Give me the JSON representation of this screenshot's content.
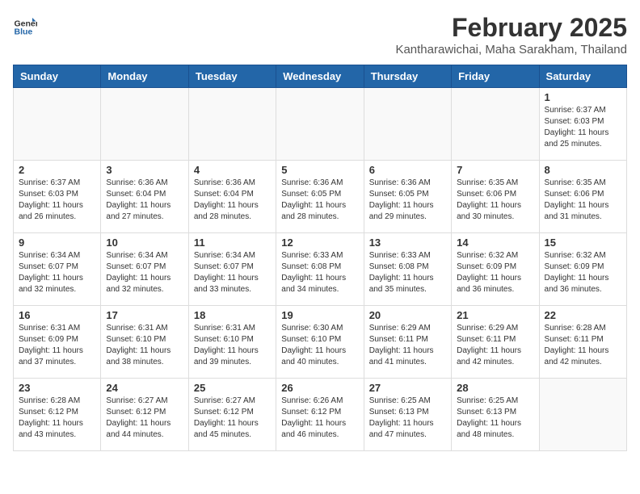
{
  "header": {
    "logo_general": "General",
    "logo_blue": "Blue",
    "month_year": "February 2025",
    "location": "Kantharawichai, Maha Sarakham, Thailand"
  },
  "days_of_week": [
    "Sunday",
    "Monday",
    "Tuesday",
    "Wednesday",
    "Thursday",
    "Friday",
    "Saturday"
  ],
  "weeks": [
    [
      {
        "day": "",
        "info": ""
      },
      {
        "day": "",
        "info": ""
      },
      {
        "day": "",
        "info": ""
      },
      {
        "day": "",
        "info": ""
      },
      {
        "day": "",
        "info": ""
      },
      {
        "day": "",
        "info": ""
      },
      {
        "day": "1",
        "info": "Sunrise: 6:37 AM\nSunset: 6:03 PM\nDaylight: 11 hours\nand 25 minutes."
      }
    ],
    [
      {
        "day": "2",
        "info": "Sunrise: 6:37 AM\nSunset: 6:03 PM\nDaylight: 11 hours\nand 26 minutes."
      },
      {
        "day": "3",
        "info": "Sunrise: 6:36 AM\nSunset: 6:04 PM\nDaylight: 11 hours\nand 27 minutes."
      },
      {
        "day": "4",
        "info": "Sunrise: 6:36 AM\nSunset: 6:04 PM\nDaylight: 11 hours\nand 28 minutes."
      },
      {
        "day": "5",
        "info": "Sunrise: 6:36 AM\nSunset: 6:05 PM\nDaylight: 11 hours\nand 28 minutes."
      },
      {
        "day": "6",
        "info": "Sunrise: 6:36 AM\nSunset: 6:05 PM\nDaylight: 11 hours\nand 29 minutes."
      },
      {
        "day": "7",
        "info": "Sunrise: 6:35 AM\nSunset: 6:06 PM\nDaylight: 11 hours\nand 30 minutes."
      },
      {
        "day": "8",
        "info": "Sunrise: 6:35 AM\nSunset: 6:06 PM\nDaylight: 11 hours\nand 31 minutes."
      }
    ],
    [
      {
        "day": "9",
        "info": "Sunrise: 6:34 AM\nSunset: 6:07 PM\nDaylight: 11 hours\nand 32 minutes."
      },
      {
        "day": "10",
        "info": "Sunrise: 6:34 AM\nSunset: 6:07 PM\nDaylight: 11 hours\nand 32 minutes."
      },
      {
        "day": "11",
        "info": "Sunrise: 6:34 AM\nSunset: 6:07 PM\nDaylight: 11 hours\nand 33 minutes."
      },
      {
        "day": "12",
        "info": "Sunrise: 6:33 AM\nSunset: 6:08 PM\nDaylight: 11 hours\nand 34 minutes."
      },
      {
        "day": "13",
        "info": "Sunrise: 6:33 AM\nSunset: 6:08 PM\nDaylight: 11 hours\nand 35 minutes."
      },
      {
        "day": "14",
        "info": "Sunrise: 6:32 AM\nSunset: 6:09 PM\nDaylight: 11 hours\nand 36 minutes."
      },
      {
        "day": "15",
        "info": "Sunrise: 6:32 AM\nSunset: 6:09 PM\nDaylight: 11 hours\nand 36 minutes."
      }
    ],
    [
      {
        "day": "16",
        "info": "Sunrise: 6:31 AM\nSunset: 6:09 PM\nDaylight: 11 hours\nand 37 minutes."
      },
      {
        "day": "17",
        "info": "Sunrise: 6:31 AM\nSunset: 6:10 PM\nDaylight: 11 hours\nand 38 minutes."
      },
      {
        "day": "18",
        "info": "Sunrise: 6:31 AM\nSunset: 6:10 PM\nDaylight: 11 hours\nand 39 minutes."
      },
      {
        "day": "19",
        "info": "Sunrise: 6:30 AM\nSunset: 6:10 PM\nDaylight: 11 hours\nand 40 minutes."
      },
      {
        "day": "20",
        "info": "Sunrise: 6:29 AM\nSunset: 6:11 PM\nDaylight: 11 hours\nand 41 minutes."
      },
      {
        "day": "21",
        "info": "Sunrise: 6:29 AM\nSunset: 6:11 PM\nDaylight: 11 hours\nand 42 minutes."
      },
      {
        "day": "22",
        "info": "Sunrise: 6:28 AM\nSunset: 6:11 PM\nDaylight: 11 hours\nand 42 minutes."
      }
    ],
    [
      {
        "day": "23",
        "info": "Sunrise: 6:28 AM\nSunset: 6:12 PM\nDaylight: 11 hours\nand 43 minutes."
      },
      {
        "day": "24",
        "info": "Sunrise: 6:27 AM\nSunset: 6:12 PM\nDaylight: 11 hours\nand 44 minutes."
      },
      {
        "day": "25",
        "info": "Sunrise: 6:27 AM\nSunset: 6:12 PM\nDaylight: 11 hours\nand 45 minutes."
      },
      {
        "day": "26",
        "info": "Sunrise: 6:26 AM\nSunset: 6:12 PM\nDaylight: 11 hours\nand 46 minutes."
      },
      {
        "day": "27",
        "info": "Sunrise: 6:25 AM\nSunset: 6:13 PM\nDaylight: 11 hours\nand 47 minutes."
      },
      {
        "day": "28",
        "info": "Sunrise: 6:25 AM\nSunset: 6:13 PM\nDaylight: 11 hours\nand 48 minutes."
      },
      {
        "day": "",
        "info": ""
      }
    ]
  ]
}
